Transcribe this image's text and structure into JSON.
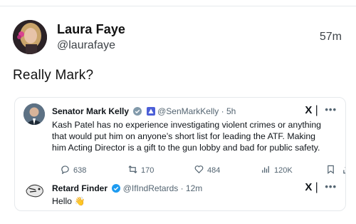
{
  "post": {
    "author_name": "Laura Faye",
    "author_handle": "@laurafaye",
    "time": "57m",
    "text": "Really Mark?"
  },
  "quoted_post": {
    "author_name": "Senator Mark Kelly",
    "author_meta": "@SenMarkKelly · 5h",
    "text": "Kash Patel has no experience investigating violent crimes or anything that would put him on anyone’s short list for leading the ATF. Making him Acting Director is a gift to the gun lobby and bad for public safety.",
    "x_logo": "X❘",
    "more": "•••",
    "stats": {
      "replies": "638",
      "reposts": "170",
      "likes": "484",
      "views": "120K"
    }
  },
  "reply_post": {
    "author_name": "Retard Finder",
    "author_meta": "@IfIndRetards · 12m",
    "text": "Hello",
    "emoji": "👋",
    "x_logo": "X❘",
    "more": "•••"
  },
  "colors": {
    "verified_blue": "#1d9bf0",
    "verified_gray": "#829aab",
    "muted_text": "#536471",
    "border": "#e6e9ec"
  },
  "icons": [
    "reply-icon",
    "repost-icon",
    "like-icon",
    "views-icon",
    "bookmark-icon",
    "share-icon",
    "verified-badge-icon",
    "government-badge-icon"
  ]
}
